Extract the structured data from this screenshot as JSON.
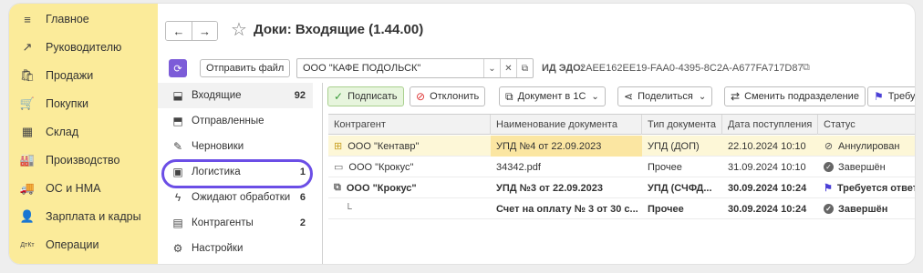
{
  "nav": {
    "items": [
      {
        "icon": "menu-icon",
        "glyph": "≡",
        "label": "Главное"
      },
      {
        "icon": "trend-icon",
        "glyph": "↗",
        "label": "Руководителю"
      },
      {
        "icon": "bag-icon",
        "glyph": "🛍",
        "label": "Продажи"
      },
      {
        "icon": "cart-icon",
        "glyph": "🛒",
        "label": "Покупки"
      },
      {
        "icon": "warehouse-icon",
        "glyph": "▦",
        "label": "Склад"
      },
      {
        "icon": "factory-icon",
        "glyph": "🏭",
        "label": "Производство"
      },
      {
        "icon": "truck-icon",
        "glyph": "🚚",
        "label": "ОС и НМА"
      },
      {
        "icon": "person-icon",
        "glyph": "👤",
        "label": "Зарплата и кадры"
      },
      {
        "icon": "operations-icon",
        "glyph": "ДтКт",
        "label": "Операции"
      }
    ]
  },
  "header": {
    "back": "←",
    "forward": "→",
    "star": "☆",
    "title": "Доки: Входящие (1.44.00)"
  },
  "toolbar": {
    "send_file": "Отправить файл",
    "counterparty_value": "ООО \"КАФЕ ПОДОЛЬСК\"",
    "edo_label": "ИД ЭДО:",
    "edo_value": "2AEE162EE19-FAA0-4395-8C2A-A677FA717D87"
  },
  "subnav": {
    "items": [
      {
        "icon": "inbox-icon",
        "glyph": "⬓",
        "label": "Входящие",
        "count": "92"
      },
      {
        "icon": "outbox-icon",
        "glyph": "⬒",
        "label": "Отправленные",
        "count": ""
      },
      {
        "icon": "pencil-icon",
        "glyph": "✎",
        "label": "Черновики",
        "count": ""
      },
      {
        "icon": "logistics-icon",
        "glyph": "▣",
        "label": "Логистика",
        "count": "1"
      },
      {
        "icon": "lightning-icon",
        "glyph": "ϟ",
        "label": "Ожидают обработки",
        "count": "6"
      },
      {
        "icon": "contacts-icon",
        "glyph": "▤",
        "label": "Контрагенты",
        "count": "2"
      },
      {
        "icon": "settings-icon",
        "glyph": "⚙",
        "label": "Настройки",
        "count": ""
      }
    ]
  },
  "actions": {
    "sign": "Подписать",
    "reject": "Отклонить",
    "doc_1c": "Документ в 1С",
    "share": "Поделиться",
    "change_dept": "Сменить подразделение",
    "requires": "Требуе"
  },
  "table": {
    "columns": [
      "Контрагент",
      "Наименование документа",
      "Тип документа",
      "Дата поступления",
      "Статус"
    ],
    "rows": [
      {
        "counterparty": "ООО \"Кентавр\"",
        "doc": "УПД №4 от 22.09.2023",
        "type": "УПД (ДОП)",
        "date": "22.10.2024 10:10",
        "status": "Аннулирован",
        "status_kind": "cancel",
        "bold": false,
        "selected": true,
        "row_icon": "folder-icon",
        "row_glyph": "⊞"
      },
      {
        "counterparty": "ООО \"Крокус\"",
        "doc": "34342.pdf",
        "type": "Прочее",
        "date": "31.09.2024 10:10",
        "status": "Завершён",
        "status_kind": "done",
        "bold": false,
        "selected": false,
        "row_icon": "document-icon",
        "row_glyph": "▭"
      },
      {
        "counterparty": "ООО \"Крокус\"",
        "doc": "УПД №3 от 22.09.2023",
        "type": "УПД (СЧФД...",
        "date": "30.09.2024 10:24",
        "status": "Требуется ответная",
        "status_kind": "flag",
        "bold": true,
        "selected": false,
        "row_icon": "documents-icon",
        "row_glyph": "⧉"
      },
      {
        "counterparty": "",
        "doc": "Счет на оплату № 3 от 30 с...",
        "type": "Прочее",
        "date": "30.09.2024 10:24",
        "status": "Завершён",
        "status_kind": "done",
        "bold": true,
        "selected": false,
        "row_icon": "tree-branch-icon",
        "row_glyph": "└"
      }
    ]
  }
}
